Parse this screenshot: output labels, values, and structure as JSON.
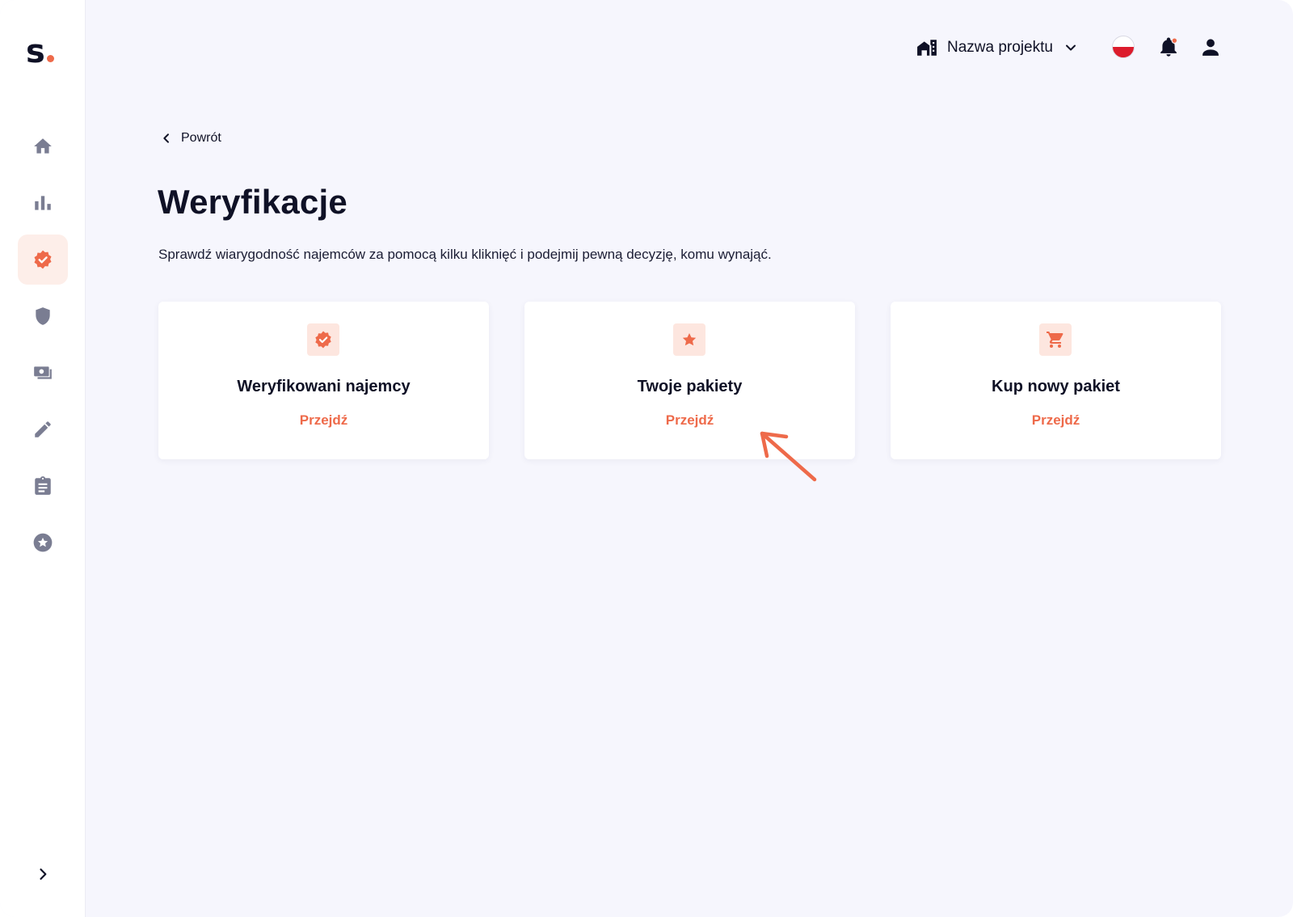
{
  "colors": {
    "accent": "#ee6a4a",
    "sidebar_icon": "#7a7d92",
    "text_dark": "#0f1126"
  },
  "sidebar": {
    "logo_text": "s",
    "items": [
      {
        "icon": "home-icon",
        "active": false
      },
      {
        "icon": "bar-chart-icon",
        "active": false
      },
      {
        "icon": "verified-badge-icon",
        "active": true
      },
      {
        "icon": "shield-icon",
        "active": false
      },
      {
        "icon": "money-icon",
        "active": false
      },
      {
        "icon": "pencil-icon",
        "active": false
      },
      {
        "icon": "clipboard-icon",
        "active": false
      },
      {
        "icon": "star-circle-icon",
        "active": false
      }
    ],
    "expand_icon": "chevron-right-icon"
  },
  "header": {
    "project_icon": "building-icon",
    "project_label": "Nazwa projektu",
    "dropdown_icon": "chevron-down-icon",
    "language_icon": "flag-pl-icon",
    "notifications_icon": "bell-icon",
    "user_icon": "user-icon"
  },
  "main": {
    "back_label": "Powrót",
    "title": "Weryfikacje",
    "description": "Sprawdź wiarygodność najemców za pomocą kilku kliknięć i podejmij pewną decyzję, komu wynająć.",
    "cards": [
      {
        "icon": "verified-badge-icon",
        "title": "Weryfikowani najemcy",
        "link": "Przejdź"
      },
      {
        "icon": "star-icon",
        "title": "Twoje pakiety",
        "link": "Przejdź"
      },
      {
        "icon": "shopping-cart-icon",
        "title": "Kup nowy pakiet",
        "link": "Przejdź"
      }
    ]
  }
}
